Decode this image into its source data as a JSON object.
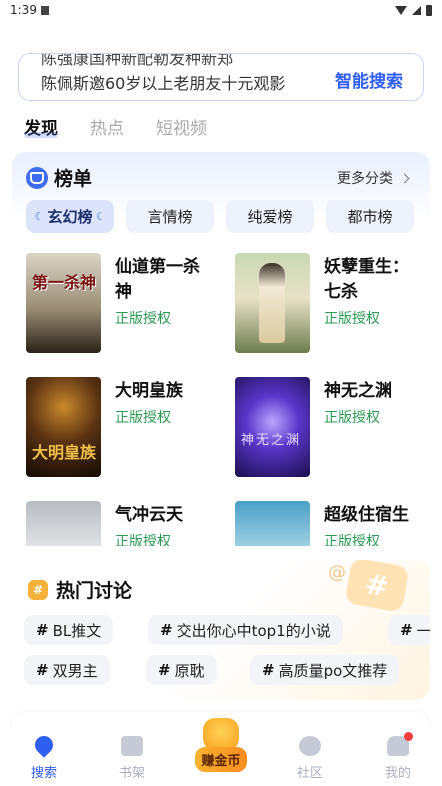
{
  "status": {
    "time": "1:39"
  },
  "search": {
    "scroll_prev": "陈强康国种新配勒发种新郑",
    "placeholder": "陈佩斯邀60岁以上老朋友十元观影",
    "button": "智能搜索"
  },
  "tabs": [
    {
      "label": "发现",
      "active": true
    },
    {
      "label": "热点",
      "active": false
    },
    {
      "label": "短视频",
      "active": false
    }
  ],
  "rank": {
    "title": "榜单",
    "more": "更多分类",
    "categories": [
      {
        "label": "玄幻榜",
        "active": true
      },
      {
        "label": "言情榜",
        "active": false
      },
      {
        "label": "纯爱榜",
        "active": false
      },
      {
        "label": "都市榜",
        "active": false
      }
    ],
    "books": [
      {
        "title": "仙道第一杀神",
        "tag": "正版授权",
        "cover_text": "第一杀神"
      },
      {
        "title": "妖孽重生：七杀",
        "tag": "正版授权",
        "cover_text": ""
      },
      {
        "title": "大明皇族",
        "tag": "正版授权",
        "cover_text": "大明皇族"
      },
      {
        "title": "神无之渊",
        "tag": "正版授权",
        "cover_text": "神无之渊"
      },
      {
        "title": "气冲云天",
        "tag": "正版授权",
        "cover_text": ""
      },
      {
        "title": "超级住宿生",
        "tag": "正版授权",
        "cover_text": ""
      }
    ]
  },
  "discuss": {
    "title": "热门讨论",
    "hash": "#",
    "chips": [
      "BL推文",
      "交出你心中top1的小说",
      "一",
      "双男主",
      "原耽",
      "高质量po文推荐"
    ]
  },
  "nav": [
    {
      "label": "搜索",
      "active": true
    },
    {
      "label": "书架",
      "active": false
    },
    {
      "label": "赚金币",
      "active": false
    },
    {
      "label": "社区",
      "active": false
    },
    {
      "label": "我的",
      "active": false
    }
  ],
  "colors": {
    "accent": "#2f5ff0",
    "tag_green": "#2b9a52",
    "badge_red": "#f03c3c"
  }
}
